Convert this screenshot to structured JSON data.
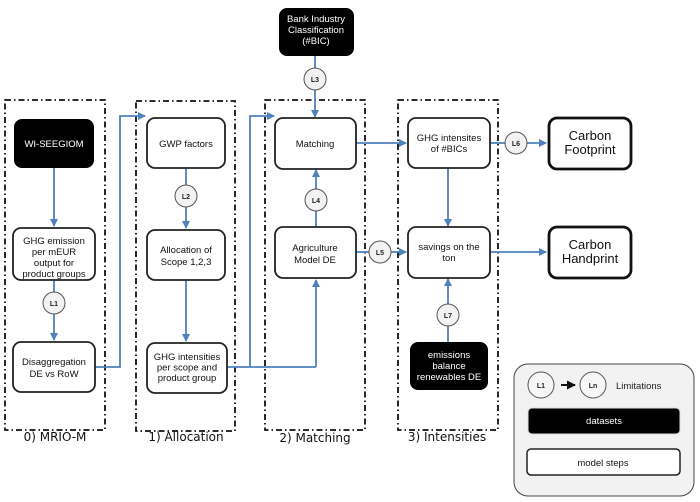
{
  "stages": [
    {
      "label": "0) MRIO-M"
    },
    {
      "label": "1) Allocation"
    },
    {
      "label": "2) Matching"
    },
    {
      "label": "3) Intensities"
    }
  ],
  "nodes": {
    "bic": {
      "lines": [
        "Bank Industry",
        "Classification",
        "(#BIC)"
      ],
      "type": "dataset"
    },
    "wi_seegiom": {
      "lines": [
        "WI-SEEGIOM"
      ],
      "type": "dataset"
    },
    "ghg_emission": {
      "lines": [
        "GHG emission",
        "per mEUR",
        "output for",
        "product groups"
      ],
      "type": "model-step"
    },
    "disaggregation": {
      "lines": [
        "Disaggregation",
        "DE vs RoW"
      ],
      "type": "model-step"
    },
    "gwp_factors": {
      "lines": [
        "GWP factors"
      ],
      "type": "model-step"
    },
    "allocation_scope": {
      "lines": [
        "Allocation of",
        "Scope 1,2,3"
      ],
      "type": "model-step"
    },
    "ghg_intensities_scope": {
      "lines": [
        "GHG intensities",
        "per scope and",
        "product group"
      ],
      "type": "model-step"
    },
    "matching": {
      "lines": [
        "Matching"
      ],
      "type": "model-step"
    },
    "agriculture_model": {
      "lines": [
        "Agriculture",
        "Model DE"
      ],
      "type": "model-step"
    },
    "ghg_intensites_bics": {
      "lines": [
        "GHG intensites",
        "of #BICs"
      ],
      "type": "model-step"
    },
    "savings_on_ton": {
      "lines": [
        "savings on the",
        "ton"
      ],
      "type": "model-step"
    },
    "emissions_balance": {
      "lines": [
        "emissions",
        "balance",
        "renewables DE"
      ],
      "type": "dataset"
    },
    "carbon_footprint": {
      "lines": [
        "Carbon",
        "Footprint"
      ],
      "type": "output"
    },
    "carbon_handprint": {
      "lines": [
        "Carbon",
        "Handprint"
      ],
      "type": "output"
    }
  },
  "limitations": [
    "L1",
    "L2",
    "L3",
    "L4",
    "L5",
    "L6",
    "L7"
  ],
  "legend": {
    "start": "L1",
    "end": "Ln",
    "limitations_label": "Limitations",
    "datasets_label": "datasets",
    "model_steps_label": "model steps"
  },
  "colors": {
    "arrow": "#4f81bd",
    "dataset_fill": "#000000",
    "legend_bg": "#f2f2f2",
    "circle_fill": "#f2f2f2"
  }
}
